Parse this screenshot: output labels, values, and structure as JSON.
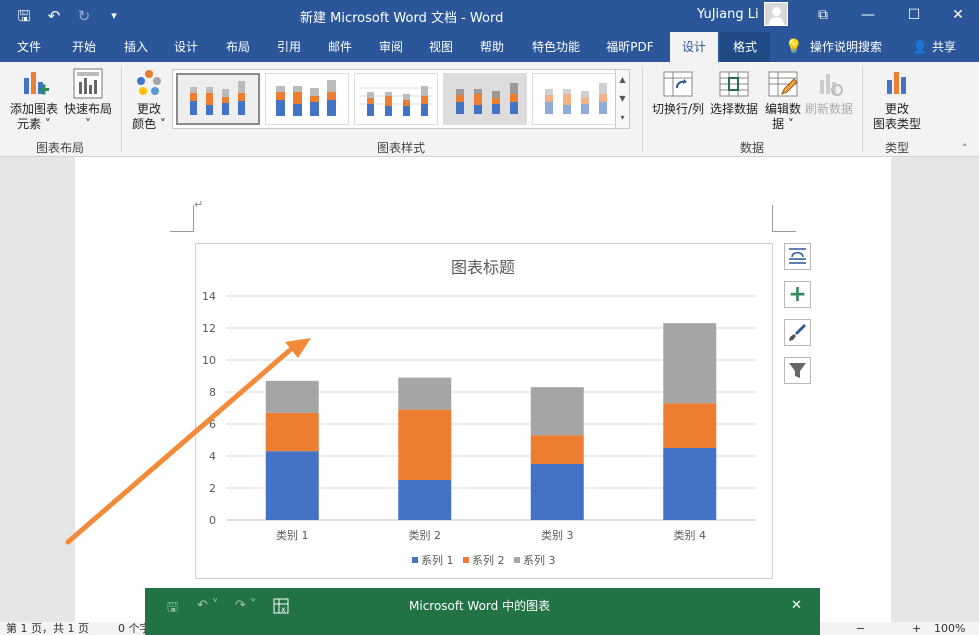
{
  "window": {
    "title": "新建 Microsoft Word 文档  -  Word",
    "user": "YuJiang Li",
    "minimize": "—",
    "restore": "☐",
    "close": "✕",
    "ribbon_display": "⧉"
  },
  "qat": {
    "save": "🖫",
    "undo": "↶",
    "redo": "↻",
    "customize": "▾"
  },
  "tabs": [
    {
      "label": "文件"
    },
    {
      "label": "开始"
    },
    {
      "label": "插入"
    },
    {
      "label": "设计"
    },
    {
      "label": "布局"
    },
    {
      "label": "引用"
    },
    {
      "label": "邮件"
    },
    {
      "label": "审阅"
    },
    {
      "label": "视图"
    },
    {
      "label": "帮助"
    },
    {
      "label": "特色功能"
    },
    {
      "label": "福昕PDF"
    },
    {
      "label": "设计"
    },
    {
      "label": "格式"
    }
  ],
  "tell_me": "操作说明搜索",
  "share": "共享",
  "ribbon": {
    "add_element": "添加图表元素",
    "add_element_l1": "添加图表",
    "add_element_l2": "元素 ˅",
    "quick_layout_l1": "快速布局",
    "quick_layout_l2": "˅",
    "group_layout": "图表布局",
    "change_colors_l1": "更改",
    "change_colors_l2": "颜色 ˅",
    "group_styles": "图表样式",
    "switch_row_col": "切换行/列",
    "select_data": "选择数据",
    "edit_data_l1": "编辑数",
    "edit_data_l2": "据 ˅",
    "refresh_data": "刷新数据",
    "group_data": "数据",
    "change_type_l1": "更改",
    "change_type_l2": "图表类型",
    "group_type": "类型",
    "collapse": "˄"
  },
  "doc": {
    "para_mark": "↵"
  },
  "chart_data": {
    "type": "bar",
    "stacked": true,
    "title": "图表标题",
    "categories": [
      "类别 1",
      "类别 2",
      "类别 3",
      "类别 4"
    ],
    "series": [
      {
        "name": "系列 1",
        "color": "#4472c4",
        "values": [
          4.3,
          2.5,
          3.5,
          4.5
        ]
      },
      {
        "name": "系列 2",
        "color": "#ed7d31",
        "values": [
          2.4,
          4.4,
          1.8,
          2.8
        ]
      },
      {
        "name": "系列 3",
        "color": "#a5a5a5",
        "values": [
          2.0,
          2.0,
          3.0,
          5.0
        ]
      }
    ],
    "yticks": [
      "0",
      "2",
      "4",
      "6",
      "8",
      "10",
      "12",
      "14"
    ],
    "ylim": [
      0,
      14
    ],
    "grid": true,
    "legend": "bottom"
  },
  "annotation": {
    "arrow_color": "#f28a3a"
  },
  "side_buttons": {
    "layout_options": "layout-options-icon",
    "chart_elements": "+",
    "chart_styles": "brush-icon",
    "chart_filters": "filter-icon"
  },
  "status": {
    "page": "第 1 页，共 1 页",
    "words": "0 个字",
    "zoom": "100%",
    "zoom_minus": "−",
    "zoom_plus": "+"
  },
  "data_window": {
    "title": "Microsoft Word 中的图表",
    "save": "🖫",
    "undo": "↶ ˅",
    "redo": "↷ ˅",
    "close": "✕"
  }
}
